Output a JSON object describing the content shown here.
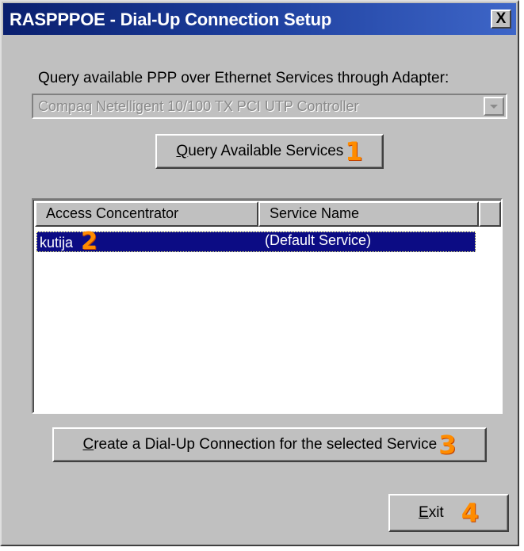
{
  "window": {
    "title": "RASPPPOE - Dial-Up Connection Setup",
    "close_label": "X"
  },
  "adapter": {
    "label": "Query available PPP over Ethernet Services through Adapter:",
    "selected": "Compaq Netelligent 10/100 TX PCI UTP Controller"
  },
  "buttons": {
    "query": {
      "mnemonic": "Q",
      "rest": "uery Available Services",
      "badge": "1"
    },
    "create": {
      "mnemonic": "C",
      "rest": "reate a Dial-Up Connection for the selected Service",
      "badge": "3"
    },
    "exit": {
      "mnemonic": "E",
      "rest": "xit",
      "badge": "4"
    }
  },
  "services": {
    "columns": [
      "Access Concentrator",
      "Service Name",
      ""
    ],
    "rows": [
      {
        "access_concentrator": "kutija",
        "service_name": "(Default Service)",
        "badge": "2",
        "selected": true
      }
    ]
  },
  "colors": {
    "title_gradient_start": "#0a1f6e",
    "title_gradient_end": "#3e66c8",
    "selection": "#0c0c84",
    "badge": "#ff8c00",
    "face": "#c0c0c0"
  }
}
